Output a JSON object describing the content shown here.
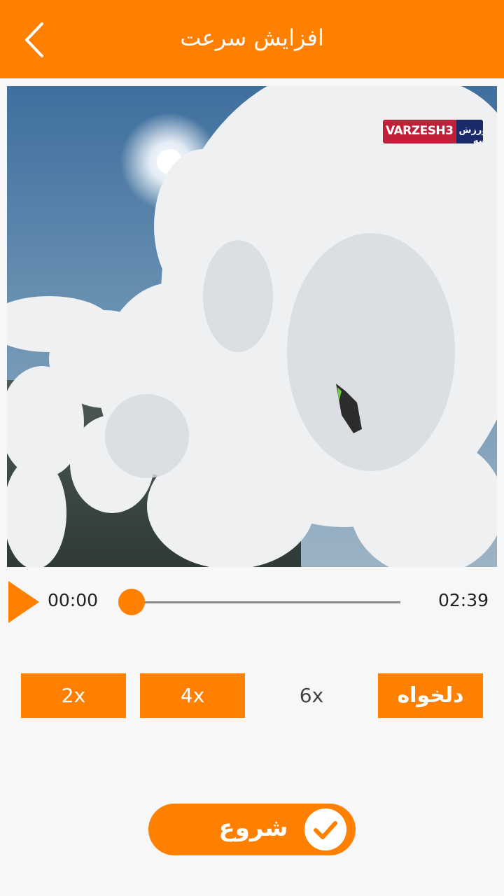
{
  "header": {
    "title": "افزایش سرعت",
    "back_icon": "chevron-left-icon"
  },
  "video": {
    "watermark_brand": "VARZESH3",
    "watermark_suffix": "ورزش سه",
    "watermark_domain": ".com"
  },
  "player": {
    "play_icon": "play-icon",
    "current_time": "00:00",
    "total_time": "02:39",
    "progress": 0
  },
  "speed_options": [
    {
      "label": "2x",
      "selected": false
    },
    {
      "label": "4x",
      "selected": false
    },
    {
      "label": "6x",
      "selected": true
    },
    {
      "label": "دلخواه",
      "selected": false
    }
  ],
  "start_button": {
    "label": "شروع",
    "icon": "check-circle-icon"
  },
  "colors": {
    "accent": "#ff7f00",
    "background": "#f7f7f7"
  }
}
